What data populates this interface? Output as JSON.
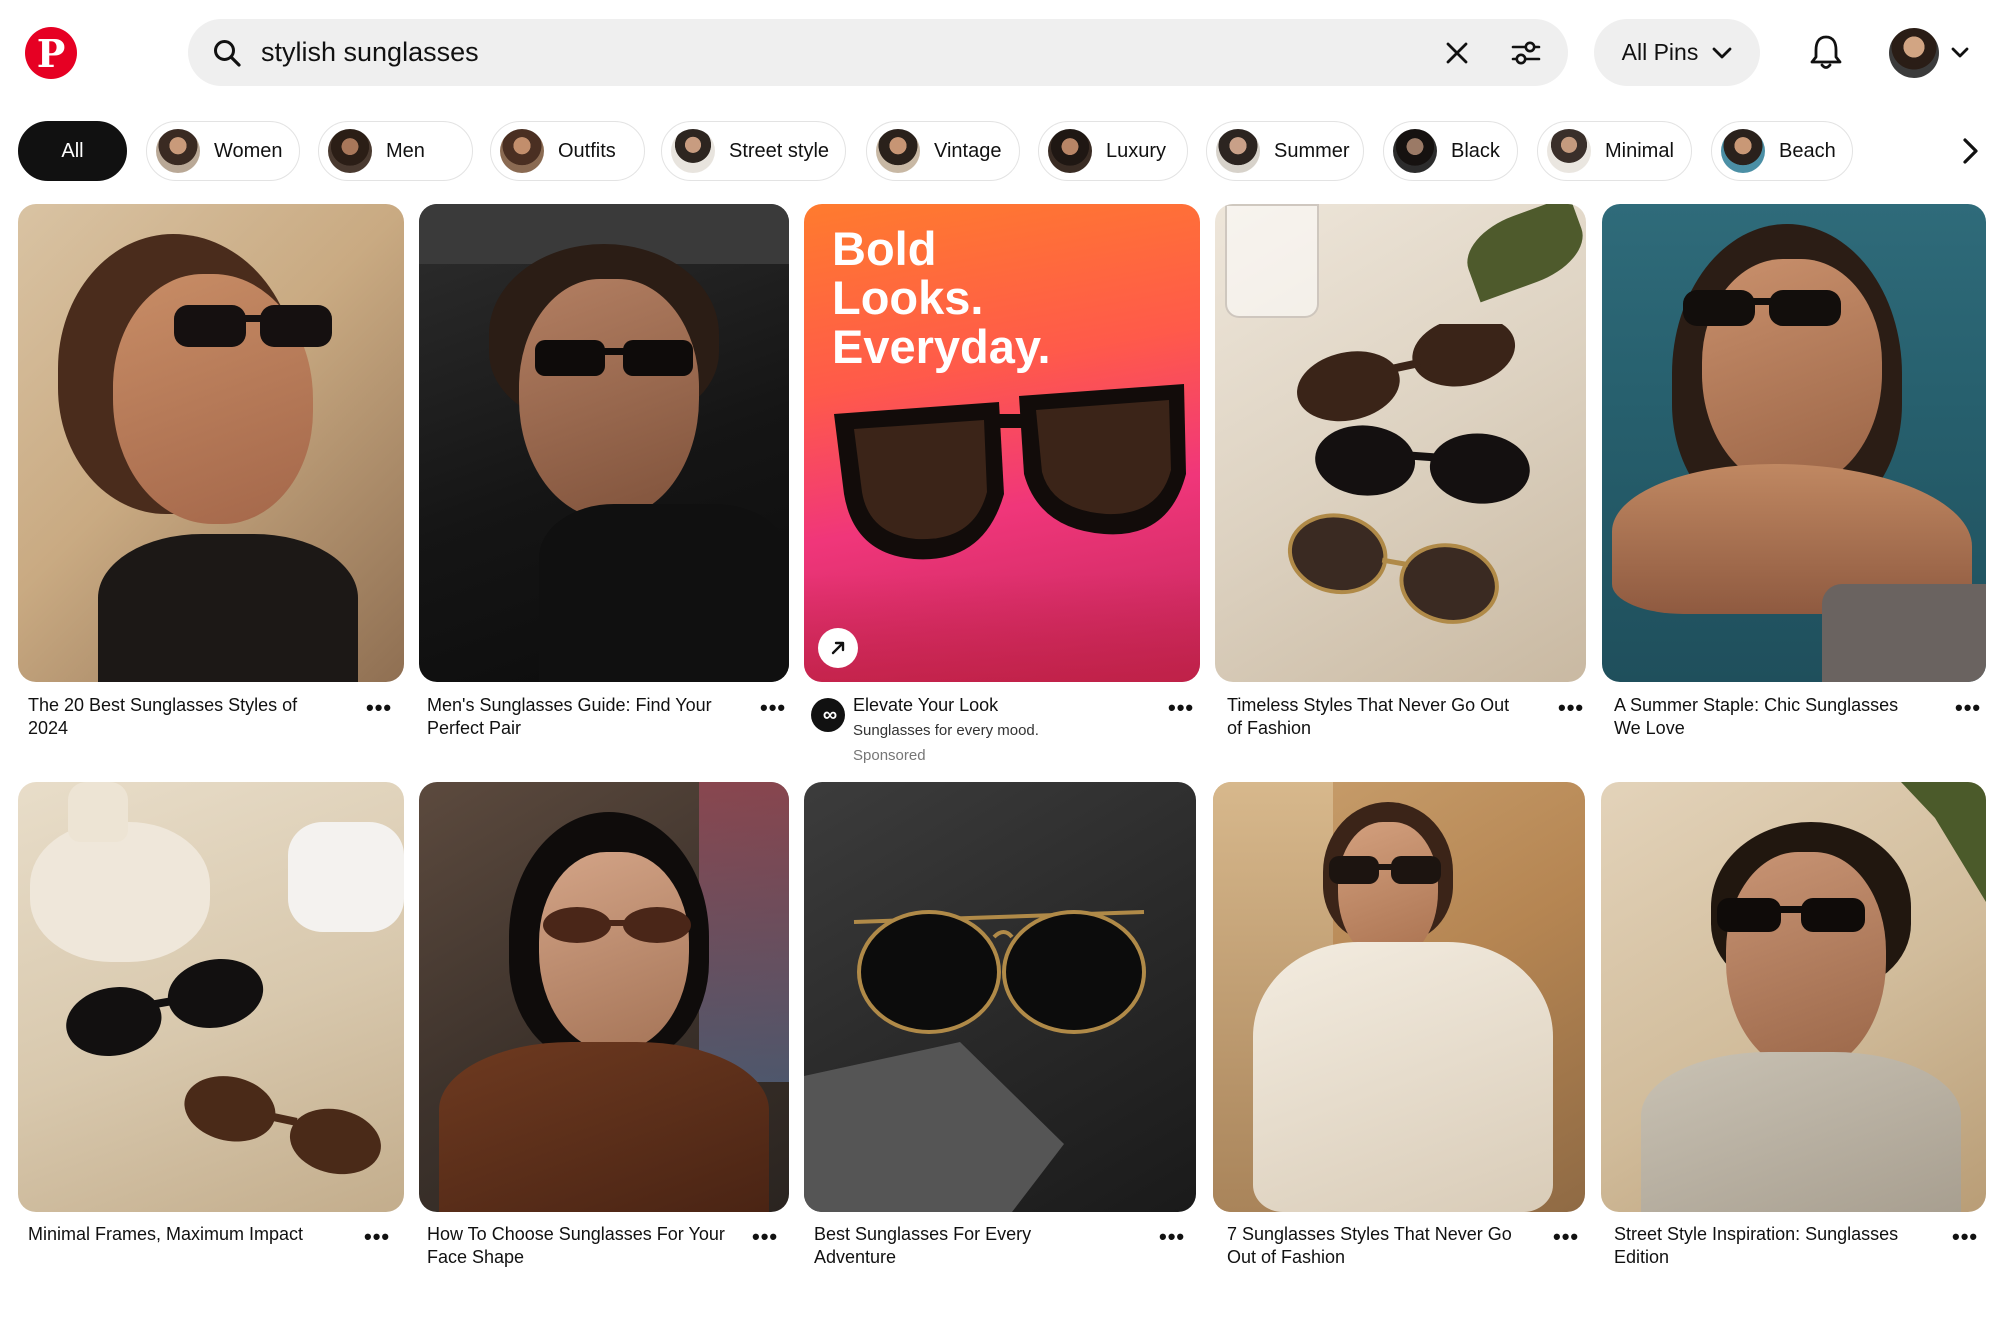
{
  "header": {
    "logo_letter": "P",
    "search": {
      "query": "stylish sunglasses"
    },
    "filter_label": "All Pins"
  },
  "chips": [
    {
      "label": "All",
      "active": true
    },
    {
      "label": "Women"
    },
    {
      "label": "Men"
    },
    {
      "label": "Outfits"
    },
    {
      "label": "Street style"
    },
    {
      "label": "Vintage"
    },
    {
      "label": "Luxury"
    },
    {
      "label": "Summer"
    },
    {
      "label": "Black"
    },
    {
      "label": "Minimal"
    },
    {
      "label": "Beach"
    }
  ],
  "pins": [
    {
      "title": "The 20 Best Sunglasses Styles of 2024"
    },
    {
      "title": "Men's Sunglasses Guide: Find Your Perfect Pair"
    },
    {
      "title": "Elevate Your Look",
      "subtitle": "Sunglasses for every mood.",
      "sponsored": "Sponsored",
      "ad_headline": "Bold\nLooks.\nEveryday."
    },
    {
      "title": "Timeless Styles That Never Go Out of Fashion"
    },
    {
      "title": "A Summer Staple: Chic Sunglasses We Love"
    },
    {
      "title": "Minimal Frames, Maximum Impact"
    },
    {
      "title": "How To Choose Sunglasses For Your Face Shape"
    },
    {
      "title": "Best Sunglasses For Every Adventure"
    },
    {
      "title": "7 Sunglasses Styles That Never Go Out of Fashion"
    },
    {
      "title": "Street Style Inspiration: Sunglasses Edition"
    }
  ],
  "more_label": "•••",
  "colors": {
    "brand": "#e60023",
    "chip_active": "#111111",
    "search_bg": "#efefef"
  }
}
